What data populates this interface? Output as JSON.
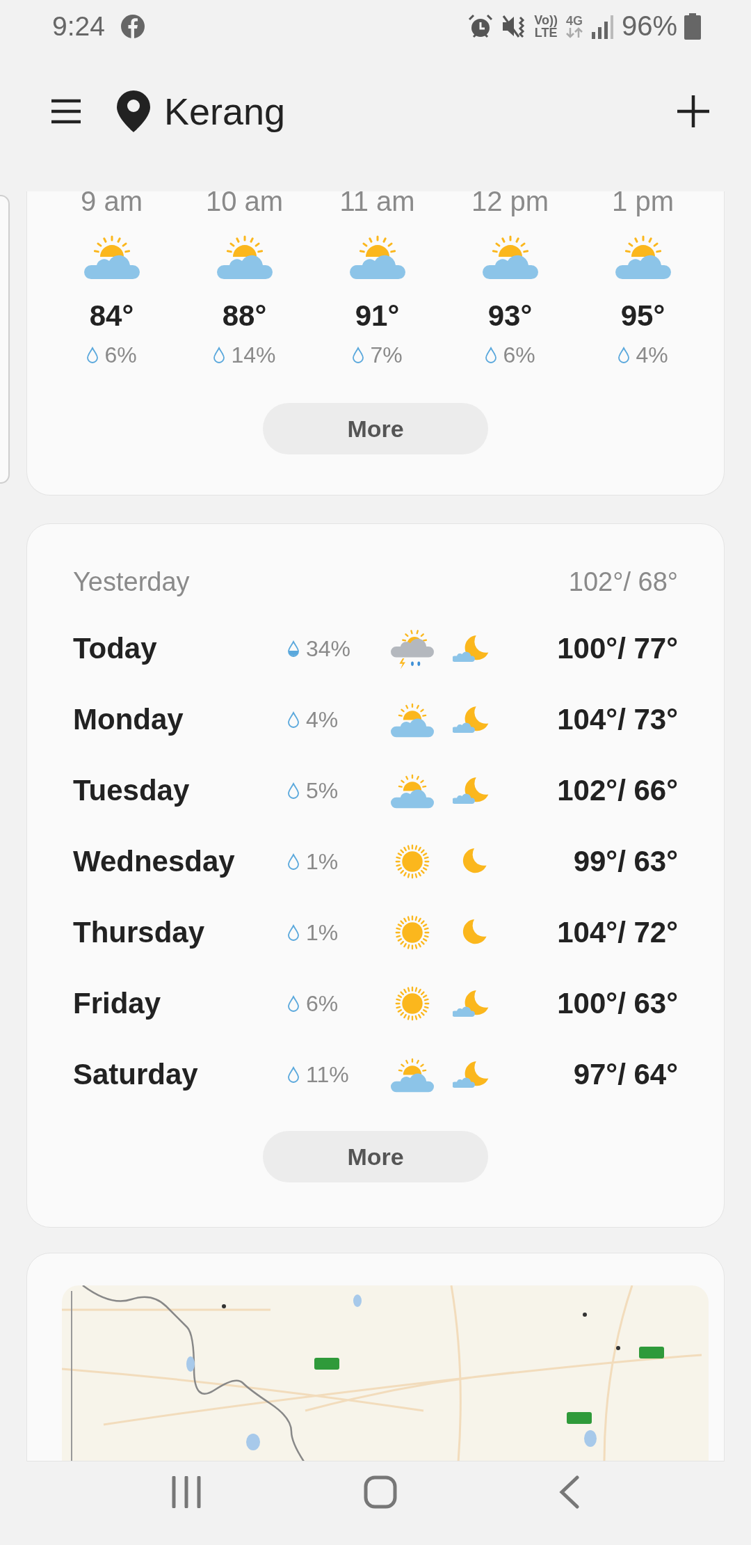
{
  "status_bar": {
    "time": "9:24",
    "volte_top": "Vo))",
    "volte_bottom": "LTE",
    "network": "4G",
    "battery": "96%"
  },
  "header": {
    "location": "Kerang"
  },
  "hourly": {
    "hours": [
      {
        "time": "9 am",
        "kind": "partly_cloudy",
        "temp": "84°",
        "precip": "6%"
      },
      {
        "time": "10 am",
        "kind": "partly_cloudy",
        "temp": "88°",
        "precip": "14%"
      },
      {
        "time": "11 am",
        "kind": "partly_cloudy",
        "temp": "91°",
        "precip": "7%"
      },
      {
        "time": "12 pm",
        "kind": "partly_cloudy",
        "temp": "93°",
        "precip": "6%"
      },
      {
        "time": "1 pm",
        "kind": "partly_cloudy",
        "temp": "95°",
        "precip": "4%"
      }
    ],
    "more": "More"
  },
  "daily": {
    "yesterday": {
      "label": "Yesterday",
      "temps": "102°/ 68°"
    },
    "days": [
      {
        "day": "Today",
        "precip": "34%",
        "drop_filled": true,
        "day_weather": {
          "kind": "storm"
        },
        "night_weather": {
          "kind": "night_cloudy"
        },
        "temps": "100°/ 77°"
      },
      {
        "day": "Monday",
        "precip": "4%",
        "drop_filled": false,
        "day_weather": {
          "kind": "partly_cloudy"
        },
        "night_weather": {
          "kind": "night_cloudy"
        },
        "temps": "104°/ 73°"
      },
      {
        "day": "Tuesday",
        "precip": "5%",
        "drop_filled": false,
        "day_weather": {
          "kind": "partly_cloudy"
        },
        "night_weather": {
          "kind": "night_cloudy"
        },
        "temps": "102°/ 66°"
      },
      {
        "day": "Wednesday",
        "precip": "1%",
        "drop_filled": false,
        "day_weather": {
          "kind": "sunny"
        },
        "night_weather": {
          "kind": "night_clear"
        },
        "temps": "99°/ 63°"
      },
      {
        "day": "Thursday",
        "precip": "1%",
        "drop_filled": false,
        "day_weather": {
          "kind": "sunny"
        },
        "night_weather": {
          "kind": "night_clear"
        },
        "temps": "104°/ 72°"
      },
      {
        "day": "Friday",
        "precip": "6%",
        "drop_filled": false,
        "day_weather": {
          "kind": "sunny"
        },
        "night_weather": {
          "kind": "night_cloudy"
        },
        "temps": "100°/ 63°"
      },
      {
        "day": "Saturday",
        "precip": "11%",
        "drop_filled": false,
        "day_weather": {
          "kind": "partly_cloudy"
        },
        "night_weather": {
          "kind": "night_cloudy"
        },
        "temps": "97°/ 64°"
      }
    ],
    "more": "More"
  }
}
